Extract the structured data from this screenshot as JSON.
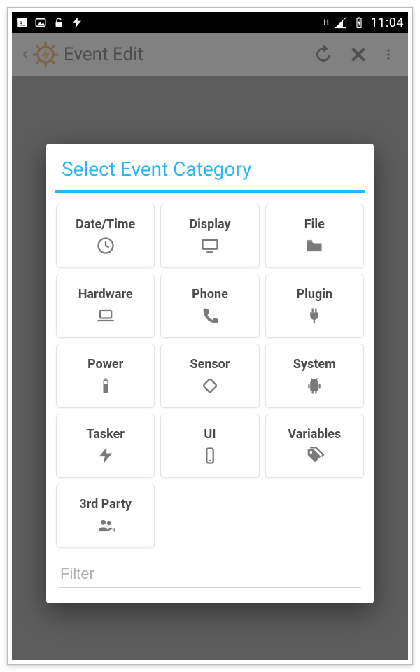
{
  "status": {
    "clock": "11:04",
    "net_indicator": "H"
  },
  "app_bar": {
    "title": "Event Edit"
  },
  "dialog": {
    "title": "Select Event Category",
    "filter_placeholder": "Filter",
    "tiles": [
      {
        "label": "Date/Time",
        "icon": "clock-icon"
      },
      {
        "label": "Display",
        "icon": "monitor-icon"
      },
      {
        "label": "File",
        "icon": "folder-icon"
      },
      {
        "label": "Hardware",
        "icon": "laptop-icon"
      },
      {
        "label": "Phone",
        "icon": "phone-icon"
      },
      {
        "label": "Plugin",
        "icon": "plug-icon"
      },
      {
        "label": "Power",
        "icon": "battery-icon"
      },
      {
        "label": "Sensor",
        "icon": "rotate-icon"
      },
      {
        "label": "System",
        "icon": "android-icon"
      },
      {
        "label": "Tasker",
        "icon": "lightning-icon"
      },
      {
        "label": "UI",
        "icon": "smartphone-icon"
      },
      {
        "label": "Variables",
        "icon": "tag-icon"
      },
      {
        "label": "3rd Party",
        "icon": "group-icon"
      }
    ]
  }
}
